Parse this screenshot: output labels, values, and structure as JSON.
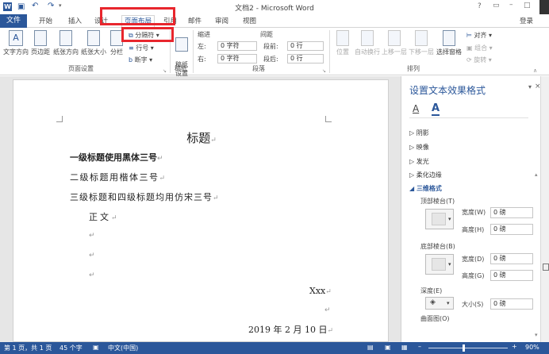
{
  "titlebar": {
    "title": "文档2 - Microsoft Word",
    "help": "?"
  },
  "tabs": {
    "file": "文件",
    "home": "开始",
    "insert": "插入",
    "design": "设计",
    "layout": "页面布局",
    "references": "引用",
    "mailings": "邮件",
    "review": "审阅",
    "view": "视图",
    "login": "登录"
  },
  "ribbon": {
    "text_direction": "文字方向",
    "margins": "页边距",
    "orientation": "纸张方向",
    "size": "纸张大小",
    "columns": "分栏",
    "breaks": "分隔符",
    "line_numbers": "行号",
    "hyphenation": "断字",
    "page_setup_group": "页面设置",
    "manuscript": "稿纸\n设置",
    "manuscript_group": "稿纸",
    "indent_label": "缩进",
    "spacing_label": "间距",
    "indent_left_label": "左:",
    "indent_left_value": "0 字符",
    "indent_right_label": "右:",
    "indent_right_value": "0 字符",
    "space_before_label": "段前:",
    "space_before_value": "0 行",
    "space_after_label": "段后:",
    "space_after_value": "0 行",
    "paragraph_group": "段落",
    "position": "位置",
    "wrap_text": "自动换行",
    "bring_forward": "上移一层",
    "send_backward": "下移一层",
    "selection_pane": "选择窗格",
    "align": "对齐",
    "group": "组合",
    "rotate": "旋转",
    "arrange_group": "排列"
  },
  "document": {
    "title": "标题",
    "h1": "一级标题使用黑体三号",
    "h2": "二级标题用楷体三号",
    "h3": "三级标题和四级标题均用仿宋三号",
    "body": "正文",
    "signature": "Xxx",
    "date": "2019 年 2 月 10 日"
  },
  "pane": {
    "title": "设置文本效果格式",
    "items": [
      "阴影",
      "映像",
      "发光",
      "柔化边缘",
      "三维格式"
    ],
    "top_bevel": "顶部棱台(T)",
    "bottom_bevel": "底部棱台(B)",
    "width_label": "宽度(W)",
    "height_label": "高度(H)",
    "width2_label": "宽度(D)",
    "height2_label": "高度(G)",
    "value": "0 磅",
    "depth": "深度(E)",
    "size_label": "大小(S)",
    "contour": "曲面图(O)"
  },
  "status": {
    "page": "第 1 页，共 1 页",
    "words": "45 个字",
    "language": "中文(中国)",
    "zoom": "90%"
  },
  "accent": "#2b579a"
}
